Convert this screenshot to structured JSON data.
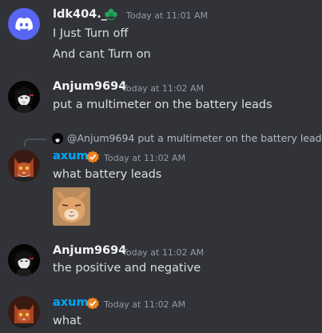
{
  "messages": [
    {
      "author": "ldk404._",
      "timestamp": "Today at 11:01 AM",
      "lines": [
        "I Just Turn off",
        "And cant Turn on"
      ],
      "author_color": "#f2f3f5"
    },
    {
      "author": "Anjum9694",
      "timestamp": "Today at 11:02 AM",
      "lines": [
        "put a multimeter on the battery leads"
      ],
      "author_color": "#f2f3f5"
    },
    {
      "reply": {
        "mention": "@Anjum9694",
        "text": "put a multimeter on the battery leads"
      },
      "author": "axum",
      "timestamp": "Today at 11:02 AM",
      "lines": [
        "what battery leads"
      ],
      "author_color": "#00a8fc",
      "attachment": "cat-image"
    },
    {
      "author": "Anjum9694",
      "timestamp": "Today at 11:02 AM",
      "lines": [
        "the positive and negative"
      ],
      "author_color": "#f2f3f5"
    },
    {
      "author": "axum",
      "timestamp": "Today at 11:02 AM",
      "lines": [
        "what"
      ],
      "author_color": "#00a8fc"
    }
  ],
  "colors": {
    "background": "#313338",
    "discord_blurple": "#5865f2",
    "badge_green": "#23a559",
    "verified_orange": "#f0831e"
  }
}
